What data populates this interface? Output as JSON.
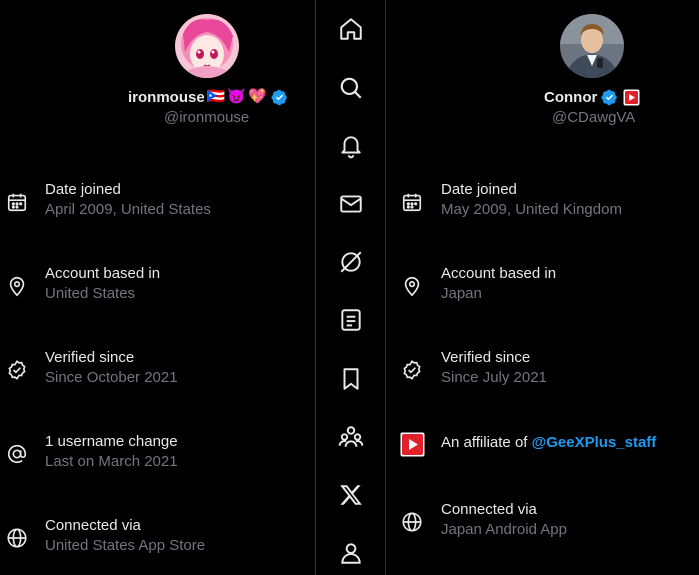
{
  "left": {
    "display_name": "ironmouse",
    "emoji": [
      "🇵🇷",
      "😈",
      "💖"
    ],
    "handle": "@ironmouse",
    "rows": [
      {
        "icon": "calendar-icon",
        "label": "Date joined",
        "value": "April 2009, United States"
      },
      {
        "icon": "location-pin-icon",
        "label": "Account based in",
        "value": "United States"
      },
      {
        "icon": "verified-check-icon",
        "label": "Verified since",
        "value": "Since October 2021"
      },
      {
        "icon": "at-sign-icon",
        "label": "1 username change",
        "value": "Last on March 2021"
      },
      {
        "icon": "globe-icon",
        "label": "Connected via",
        "value": "United States App Store"
      }
    ]
  },
  "right": {
    "display_name": "Connor",
    "handle": "@CDawgVA",
    "rows": [
      {
        "icon": "calendar-icon",
        "label": "Date joined",
        "value": "May 2009, United Kingdom"
      },
      {
        "icon": "location-pin-icon",
        "label": "Account based in",
        "value": "Japan"
      },
      {
        "icon": "verified-check-icon",
        "label": "Verified since",
        "value": "Since July 2021"
      }
    ],
    "affiliate": {
      "prefix": "An affiliate of ",
      "link": "@GeeXPlus_staff",
      "icon": "geexplus-logo-icon"
    },
    "connected": {
      "icon": "globe-icon",
      "label": "Connected via",
      "value": "Japan Android App"
    }
  },
  "nav": [
    "home-icon",
    "search-icon",
    "notifications-bell-icon",
    "messages-envelope-icon",
    "grok-icon",
    "lists-icon",
    "bookmark-icon",
    "communities-icon",
    "x-logo-icon",
    "profile-icon"
  ],
  "colors": {
    "background": "#000000",
    "primary_text": "#e7e9ea",
    "secondary_text": "#71767b",
    "accent": "#1d9bf0",
    "divider": "#2f3336"
  }
}
